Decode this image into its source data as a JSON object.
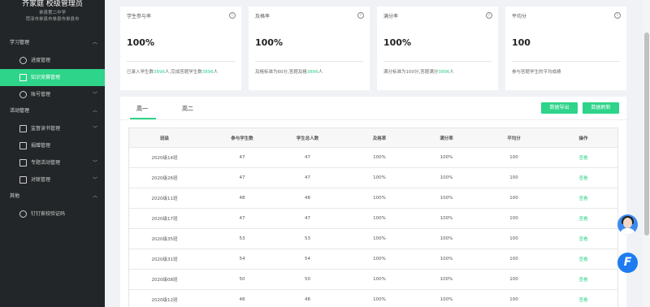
{
  "sidebar": {
    "title": "齐家庭 校级管理员",
    "school": "单县第二中学",
    "region": "菏泽市单县市单县市单县市",
    "groups": [
      {
        "label": "学习管理"
      },
      {
        "label": "活动管理"
      },
      {
        "label": "其他"
      }
    ],
    "items": [
      {
        "label": "进度管理"
      },
      {
        "label": "知识竞赛管理"
      },
      {
        "label": "账号管理"
      },
      {
        "label": "监督读书管理"
      },
      {
        "label": "捐赠管理"
      },
      {
        "label": "专题活动管理"
      },
      {
        "label": "对联管理"
      },
      {
        "label": "钉钉家校验证码"
      }
    ]
  },
  "cards": [
    {
      "label": "学生参与率",
      "value": "100%",
      "desc_pre": "已录入学生数",
      "n1": "3896",
      "desc_mid": "人,完成答题学生数",
      "n2": "3896",
      "desc_post": "人"
    },
    {
      "label": "及格率",
      "value": "100%",
      "desc_pre": "及格标准为60分,答题及格",
      "n1": "3896",
      "desc_mid": "人",
      "n2": "",
      "desc_post": ""
    },
    {
      "label": "满分率",
      "value": "100%",
      "desc_pre": "满分标准为100分,答题满分",
      "n1": "3896",
      "desc_mid": "人",
      "n2": "",
      "desc_post": ""
    },
    {
      "label": "平均分",
      "value": "100",
      "desc_pre": "参与答题学生的平均成绩",
      "n1": "",
      "desc_mid": "",
      "n2": "",
      "desc_post": ""
    }
  ],
  "tabs": [
    "高一",
    "高二"
  ],
  "buttons": {
    "export": "数据导出",
    "refresh": "数据刷新"
  },
  "table": {
    "headers": [
      "班级",
      "参与学生数",
      "学生总人数",
      "及格率",
      "满分率",
      "平均分",
      "操作"
    ],
    "rows": [
      [
        "2020级14班",
        "47",
        "47",
        "100%",
        "100%",
        "100",
        "查看"
      ],
      [
        "2020级26班",
        "47",
        "47",
        "100%",
        "100%",
        "100",
        "查看"
      ],
      [
        "2020级11班",
        "48",
        "48",
        "100%",
        "100%",
        "100",
        "查看"
      ],
      [
        "2020级17班",
        "47",
        "47",
        "100%",
        "100%",
        "100",
        "查看"
      ],
      [
        "2020级35班",
        "53",
        "53",
        "100%",
        "100%",
        "100",
        "查看"
      ],
      [
        "2020级31班",
        "54",
        "54",
        "100%",
        "100%",
        "100",
        "查看"
      ],
      [
        "2020级08班",
        "50",
        "50",
        "100%",
        "100%",
        "100",
        "查看"
      ],
      [
        "2020级12班",
        "48",
        "48",
        "100%",
        "100%",
        "100",
        "查看"
      ]
    ]
  },
  "colors": {
    "accent": "#2ed489",
    "sidebar_bg": "#232628"
  }
}
